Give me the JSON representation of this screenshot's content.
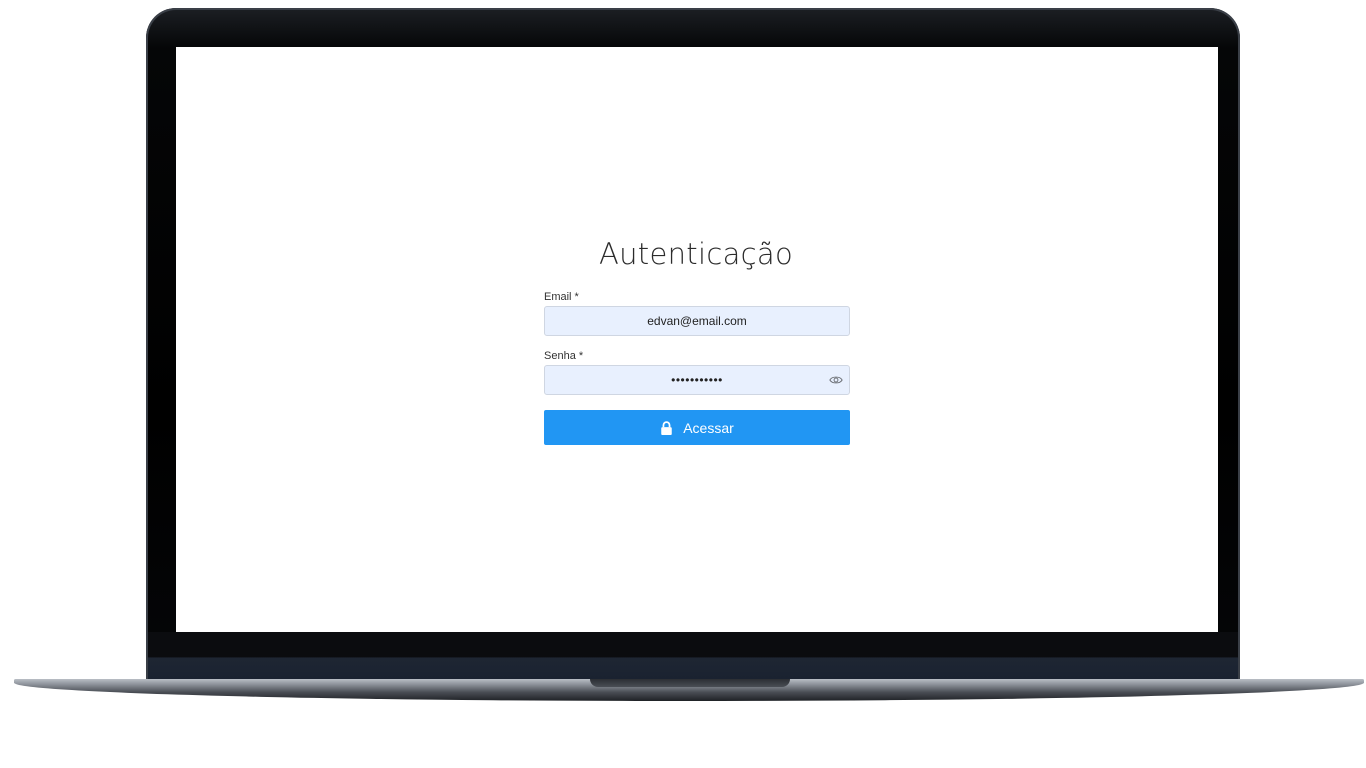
{
  "login": {
    "title": "Autenticação",
    "email_label": "Email *",
    "email_value": "edvan@email.com",
    "password_label": "Senha *",
    "password_value": "•••••••••••",
    "submit_label": "Acessar"
  },
  "icons": {
    "password_toggle": "eye-icon",
    "submit": "lock-icon"
  },
  "colors": {
    "accent": "#2196f3",
    "input_bg": "#e8f0fe"
  }
}
